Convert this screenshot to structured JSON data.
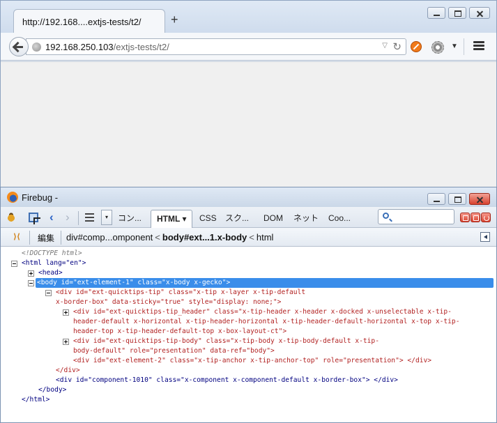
{
  "browser": {
    "tab_title": "http://192.168....extjs-tests/t2/",
    "new_tab_label": "+",
    "url_host": "192.168.250.103",
    "url_path": "/extjs-tests/t2/"
  },
  "firebug": {
    "title": "Firebug -",
    "panels": [
      "コン...",
      "HTML",
      "CSS",
      "スク...",
      "DOM",
      "ネット",
      "Coo..."
    ],
    "active_panel": "HTML",
    "edit_label": "編集",
    "breadcrumbs": [
      "div#comp...omponent",
      "body#ext...1.x-body",
      "html"
    ],
    "breadcrumb_sep": "<"
  },
  "tree": {
    "doctype": "<!DOCTYPE html>",
    "html_open": "<html lang=\"en\">",
    "head": "<head>",
    "body_open": "<body id=\"ext-element-1\" class=\"x-body x-gecko\">",
    "qt_open_1": "<div id=\"ext-quicktips-tip\" class=\"x-tip x-layer x-tip-default",
    "qt_open_2": "x-border-box\" data-sticky=\"true\" style=\"display: none;\">",
    "hdr_1": "<div id=\"ext-quicktips-tip_header\" class=\"x-tip-header x-header x-docked x-unselectable x-tip-",
    "hdr_2": "header-default x-horizontal x-tip-header-horizontal x-tip-header-default-horizontal x-top x-tip-",
    "hdr_3": "header-top x-tip-header-default-top x-box-layout-ct\">",
    "tbody_1": "<div id=\"ext-quicktips-tip-body\" class=\"x-tip-body x-tip-body-default x-tip-",
    "tbody_2": "body-default\" role=\"presentation\" data-ref=\"body\">",
    "elem2": "<div id=\"ext-element-2\" class=\"x-tip-anchor x-tip-anchor-top\" role=\"presentation\"> </div>",
    "qt_close": "</div>",
    "comp": "<div id=\"component-1010\" class=\"x-component x-component-default x-border-box\"> </div>",
    "body_close": "</body>",
    "html_close": "</html>"
  },
  "colors": {
    "selection": "#3a8dea",
    "tag_blue": "#000080",
    "tag_red": "#b22222"
  }
}
